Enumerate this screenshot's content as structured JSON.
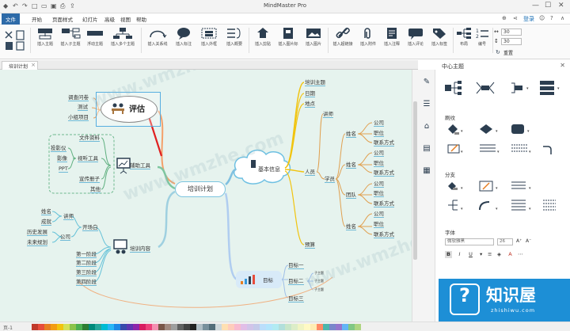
{
  "window": {
    "title": "MindMaster Pro",
    "login": "登录",
    "quick_access_icons": [
      "undo-icon",
      "redo-icon",
      "new-icon",
      "open-icon",
      "save-icon",
      "print-icon",
      "export-icon"
    ],
    "control_icons": [
      "minimize-icon",
      "maximize-icon",
      "close-icon"
    ],
    "right_icons": [
      "cart-icon",
      "share-icon"
    ]
  },
  "menu": {
    "items": [
      "文件",
      "开始",
      "页面样式",
      "幻灯片",
      "高级",
      "视图",
      "帮助"
    ],
    "active": "文件"
  },
  "ribbon": {
    "buttons": [
      "插入主题",
      "插入子主题",
      "浮动主题",
      "插入多个主题",
      "插入关系线",
      "插入标注",
      "插入外框",
      "插入概要",
      "插入剪贴",
      "插入图片标",
      "插入图片",
      "插入超链接",
      "插入附件",
      "插入注释",
      "插入评论",
      "插入标签",
      "布局",
      "编号"
    ],
    "spin_top": "30",
    "spin_bottom": "30",
    "reset": "重置"
  },
  "document": {
    "tab_label": "培训计划"
  },
  "mindmap": {
    "central": "培训计划",
    "evaluation": {
      "title": "评估",
      "items": [
        "调查问卷",
        "测试",
        "小组项目"
      ]
    },
    "basic_info": {
      "title": "基本信息",
      "items": [
        "培训主题",
        "日期",
        "地点",
        "人员",
        "预算"
      ],
      "people": {
        "lecturer": "讲师",
        "participants": "学员",
        "name": "姓名",
        "team": "团队",
        "company": "公司",
        "position": "职位",
        "contact": "联系方式"
      }
    },
    "aids": {
      "title": "辅助工具",
      "docs": "文件资料",
      "av": "视听工具",
      "av_items": [
        "投影仪",
        "影像",
        "PPT"
      ],
      "props": "宣传册子",
      "other": "其他"
    },
    "content": {
      "title": "培训内容",
      "opening": "开场白",
      "lecturer": "讲师",
      "company": "公司",
      "lecturer_items": [
        "姓名",
        "成就"
      ],
      "company_items": [
        "历史发展",
        "未来规划"
      ],
      "stages": [
        "第一阶段",
        "第二阶段",
        "第三阶段",
        "第四阶段"
      ]
    },
    "goals": {
      "title": "目标",
      "items": [
        "目标一",
        "目标二",
        "目标三"
      ],
      "sub": [
        "子主题",
        "子主题",
        "子主题"
      ]
    }
  },
  "right_panel": {
    "title": "中心主题",
    "shape_label": "刷纹",
    "branch_label": "分支",
    "font_label": "字体",
    "font_name": "微软雅黑",
    "font_size": "26",
    "format_buttons": [
      "B",
      "I",
      "U",
      "A"
    ]
  },
  "statusbar": {
    "page": "页-1",
    "palette": [
      "#c0392b",
      "#e74c3c",
      "#e67e22",
      "#f39c12",
      "#f1c40f",
      "#d4e157",
      "#8bc34a",
      "#4caf50",
      "#2e7d32",
      "#00897b",
      "#26a69a",
      "#00bcd4",
      "#29b6f6",
      "#1e88e5",
      "#3949ab",
      "#5e35b1",
      "#8e24aa",
      "#d81b60",
      "#ec407a",
      "#f48fb1",
      "#795548",
      "#a1887f",
      "#9e9e9e",
      "#616161",
      "#424242",
      "#212121",
      "#b0bec5",
      "#78909c",
      "#546e7a",
      "#cfd8dc",
      "#ffe0b2",
      "#ffccbc",
      "#f8bbd0",
      "#e1bee7",
      "#d1c4e9",
      "#c5cae9",
      "#bbdefb",
      "#b3e5fc",
      "#b2ebf2",
      "#b2dfdb",
      "#c8e6c9",
      "#dcedc8",
      "#f0f4c3",
      "#fff9c4",
      "#ffecb3",
      "#ff8a65",
      "#4db6ac",
      "#7986cb",
      "#9575cd",
      "#64b5f6",
      "#81c784",
      "#aed581"
    ]
  },
  "watermark": {
    "text": "www.wmzhe.com",
    "logo_cn": "知识屋",
    "logo_en": "zhishiwu.com"
  }
}
